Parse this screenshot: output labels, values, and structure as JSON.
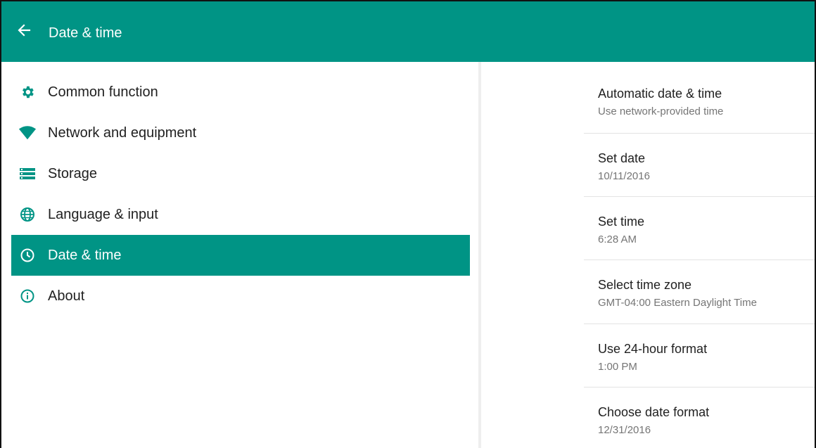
{
  "appbar": {
    "title": "Date & time",
    "back_icon": "arrow-left-icon",
    "color": "#009485"
  },
  "nav": {
    "active_color": "#009485",
    "items": [
      {
        "label": "Common function",
        "icon": "gear-icon"
      },
      {
        "label": "Network and equipment",
        "icon": "wifi-icon"
      },
      {
        "label": "Storage",
        "icon": "storage-icon"
      },
      {
        "label": "Language & input",
        "icon": "globe-icon"
      },
      {
        "label": "Date & time",
        "icon": "clock-icon",
        "active": true
      },
      {
        "label": "About",
        "icon": "info-icon"
      }
    ]
  },
  "prefs": {
    "items": [
      {
        "title": "Automatic date & time",
        "summary": "Use network-provided time"
      },
      {
        "title": "Set date",
        "summary": "10/11/2016"
      },
      {
        "title": "Set time",
        "summary": "6:28 AM"
      },
      {
        "title": "Select time zone",
        "summary": "GMT-04:00 Eastern Daylight Time"
      },
      {
        "title": "Use 24-hour format",
        "summary": "1:00 PM"
      },
      {
        "title": "Choose date format",
        "summary": "12/31/2016"
      }
    ]
  }
}
